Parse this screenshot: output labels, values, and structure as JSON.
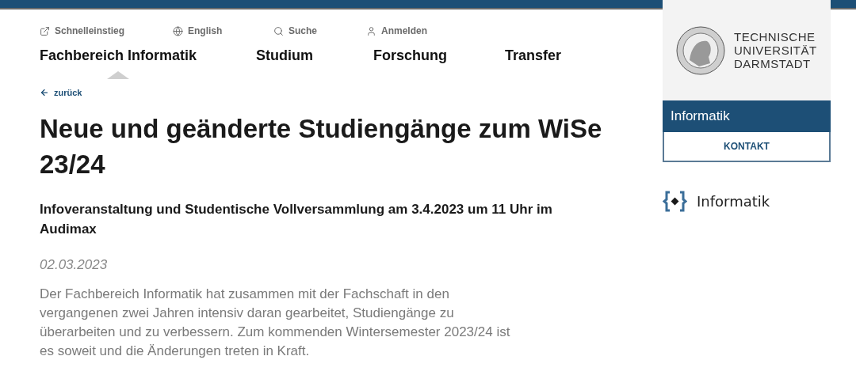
{
  "utility_links": [
    {
      "kind": "external",
      "label": "Schnelleinstieg"
    },
    {
      "kind": "language",
      "label": "English"
    },
    {
      "kind": "search",
      "label": "Suche"
    },
    {
      "kind": "user",
      "label": "Anmelden"
    }
  ],
  "nav": [
    {
      "label": "Fachbereich Informatik",
      "selected": true
    },
    {
      "label": "Studium",
      "selected": false
    },
    {
      "label": "Forschung",
      "selected": false
    },
    {
      "label": "Transfer",
      "selected": false
    }
  ],
  "back_link": "zurück",
  "article": {
    "title": "Neue und geänderte Studiengänge zum WiSe 23/24",
    "subtitle": "Infoveranstaltung und Studentische Vollversammlung am 3.4.2023 um 11 Uhr im Audimax",
    "date": "02.03.2023",
    "body": "Der Fachbereich Informatik hat zusammen mit der Fachschaft in den vergangenen zwei Jahren intensiv daran gearbeitet, Studiengänge zu überarbeiten und zu verbessern. Zum kommenden Wintersemester 2023/24 ist es soweit und die Änderungen treten in Kraft."
  },
  "sidebar": {
    "university_lines": [
      "TECHNISCHE",
      "UNIVERSITÄT",
      "DARMSTADT"
    ],
    "department": "Informatik",
    "contact_button": "KONTAKT",
    "brand": "Informatik"
  }
}
